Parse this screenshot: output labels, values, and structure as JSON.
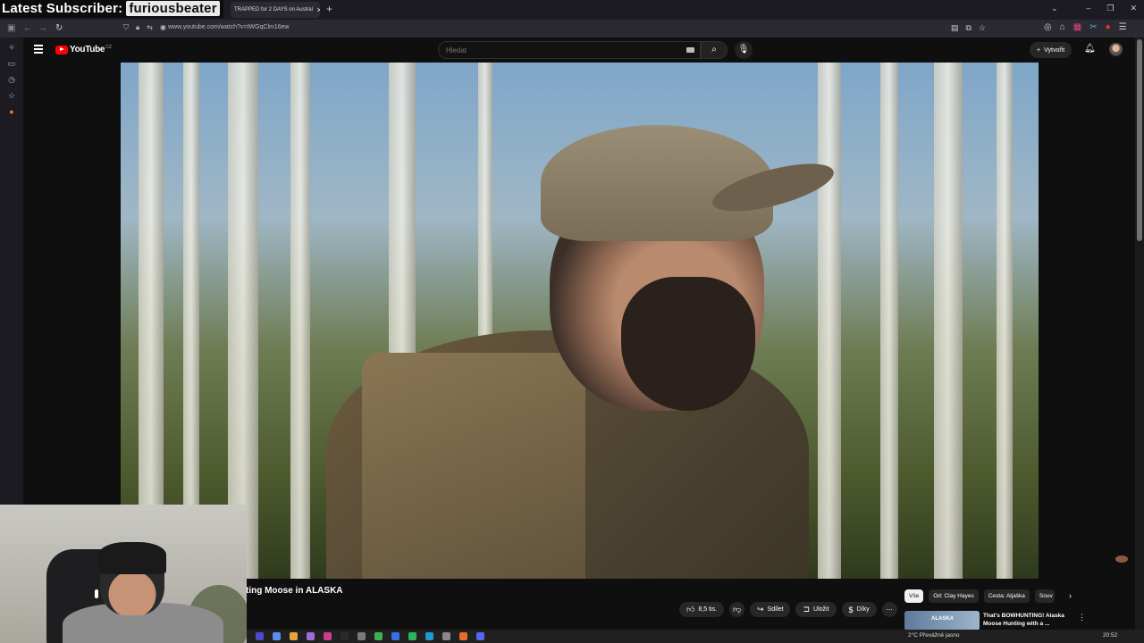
{
  "overlay": {
    "label": "Latest Subscriber:",
    "name": "furiousbeater"
  },
  "browser": {
    "tab_title": "TRAPPED for 2 DAYS on Austral",
    "tab_close": "✕",
    "new_tab": "+",
    "url": "www.youtube.com/watch?v=tWGqClm16ew",
    "back": "←",
    "forward": "→",
    "reload": "↻",
    "tab_dropdown": "⌄",
    "window_controls": {
      "minimize": "–",
      "maximize": "❐",
      "close": "✕"
    }
  },
  "youtube": {
    "logo_text": "YouTube",
    "country_code": "CZ",
    "search_placeholder": "Hledat",
    "create_label": "Vytvořit"
  },
  "video": {
    "title_fragment": "ting Moose in ALASKA"
  },
  "actions": {
    "like_count": "8,5 tis.",
    "share_label": "Sdílet",
    "save_label": "Uložit",
    "thanks_label": "Díky",
    "more": "⋯"
  },
  "chips": [
    "Vše",
    "Od: Clay Hayes",
    "Cesta: Aljaška",
    "Souv"
  ],
  "recommendation": {
    "thumb_text": "ALASKA",
    "title": "That's BOWHUNTING! Alaska Moose Hunting with a ...",
    "menu": "⋮"
  },
  "taskbar": {
    "weather": "2°C  Převážně jasno",
    "time": "20:52"
  }
}
